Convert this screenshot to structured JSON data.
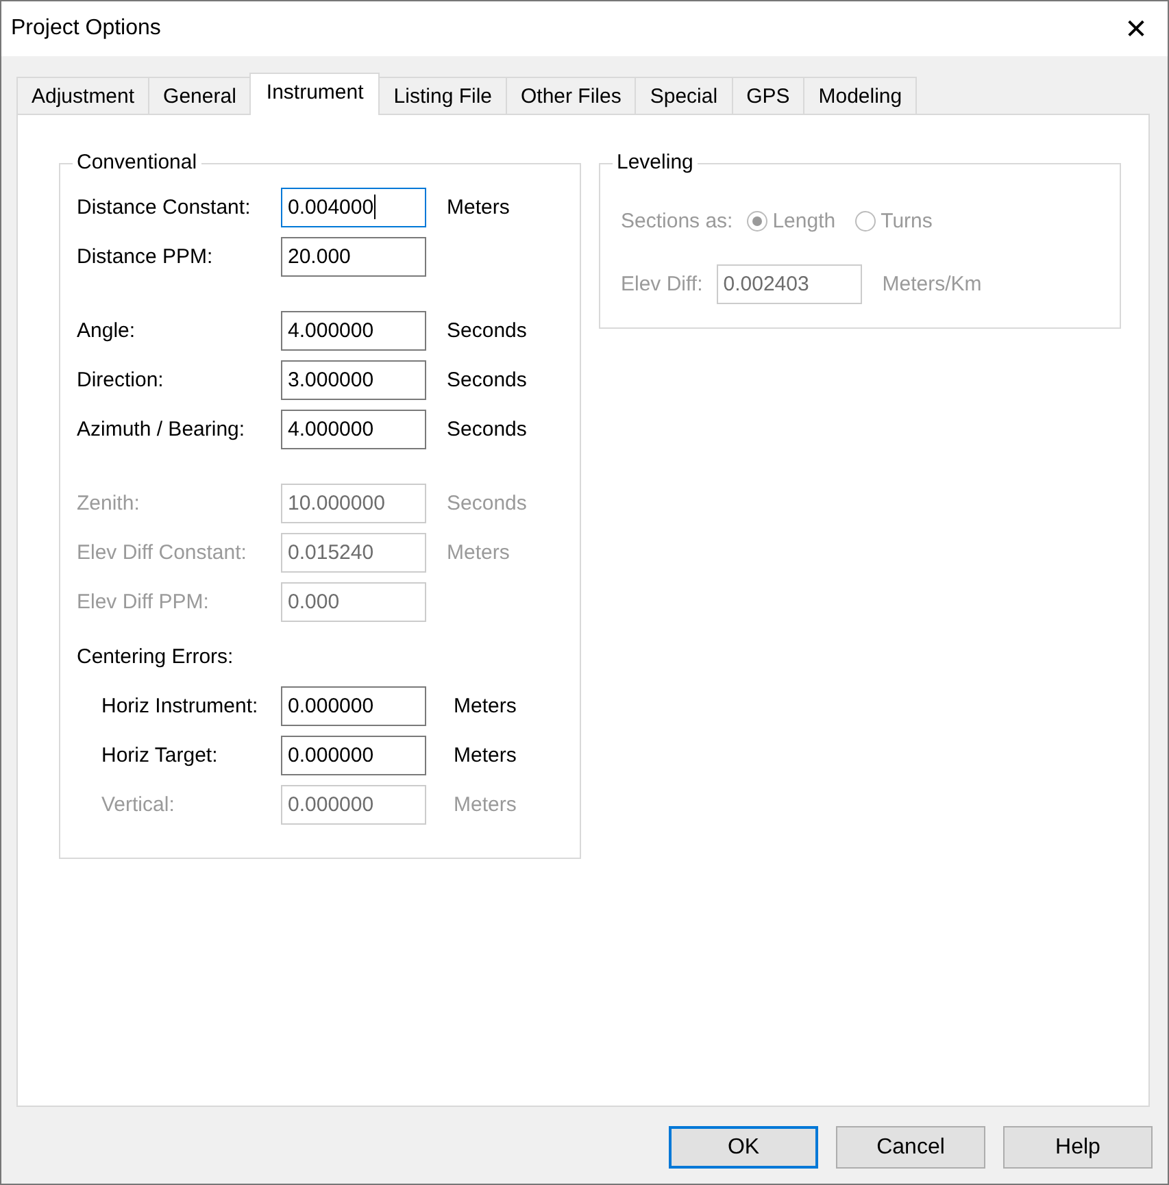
{
  "window": {
    "title": "Project Options",
    "close": "✕"
  },
  "tabs": [
    {
      "label": "Adjustment",
      "selected": false
    },
    {
      "label": "General",
      "selected": false
    },
    {
      "label": "Instrument",
      "selected": true
    },
    {
      "label": "Listing File",
      "selected": false
    },
    {
      "label": "Other Files",
      "selected": false
    },
    {
      "label": "Special",
      "selected": false
    },
    {
      "label": "GPS",
      "selected": false
    },
    {
      "label": "Modeling",
      "selected": false
    }
  ],
  "conventional": {
    "title": "Conventional",
    "sections": [
      {
        "rows": [
          {
            "label": "Distance Constant:",
            "value": "0.004000",
            "unit": "Meters",
            "disabled": false,
            "focused": true
          },
          {
            "label": "Distance PPM:",
            "value": "20.000",
            "disabled": false,
            "focused": false
          }
        ]
      },
      {
        "rows": [
          {
            "label": "Angle:",
            "value": "4.000000",
            "unit": "Seconds",
            "disabled": false,
            "focused": false
          },
          {
            "label": "Direction:",
            "value": "3.000000",
            "unit": "Seconds",
            "disabled": false,
            "focused": false
          },
          {
            "label": "Azimuth / Bearing:",
            "value": "4.000000",
            "unit": "Seconds",
            "disabled": false,
            "focused": false
          }
        ]
      },
      {
        "rows": [
          {
            "label": "Zenith:",
            "value": "10.000000",
            "unit": "Seconds",
            "disabled": true,
            "focused": false
          },
          {
            "label": "Elev Diff Constant:",
            "value": "0.015240",
            "unit": "Meters",
            "disabled": true,
            "focused": false
          },
          {
            "label": "Elev Diff PPM:",
            "value": "0.000",
            "disabled": true,
            "focused": false
          }
        ]
      },
      {
        "heading": "Centering Errors:",
        "rows": [
          {
            "label": "Horiz Instrument:",
            "value": "0.000000",
            "unit": "Meters",
            "disabled": false,
            "focused": false
          },
          {
            "label": "Horiz Target:",
            "value": "0.000000",
            "unit": "Meters",
            "disabled": false,
            "focused": false
          },
          {
            "label": "Vertical:",
            "value": "0.000000",
            "unit": "Meters",
            "disabled": true,
            "focused": false
          }
        ]
      }
    ]
  },
  "leveling": {
    "title": "Leveling",
    "disabled": true,
    "sections_label": "Sections as:",
    "options": [
      {
        "label": "Length",
        "selected": true
      },
      {
        "label": "Turns",
        "selected": false
      }
    ],
    "elev_diff": {
      "label": "Elev Diff:",
      "value": "0.002403",
      "unit": "Meters/Km"
    }
  },
  "buttons": [
    {
      "label": "OK",
      "default": true
    },
    {
      "label": "Cancel",
      "default": false
    },
    {
      "label": "Help",
      "default": false
    }
  ]
}
